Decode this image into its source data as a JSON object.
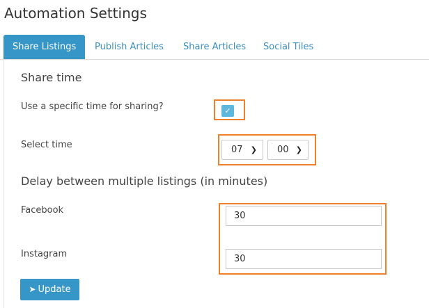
{
  "page": {
    "title": "Automation Settings"
  },
  "tabs": [
    {
      "label": "Share Listings",
      "active": true
    },
    {
      "label": "Publish Articles",
      "active": false
    },
    {
      "label": "Share Articles",
      "active": false
    },
    {
      "label": "Social Tiles",
      "active": false
    }
  ],
  "share_time": {
    "title": "Share time",
    "specific_time_label": "Use a specific time for sharing?",
    "specific_time_checked": true,
    "select_time_label": "Select time",
    "hour_value": "07",
    "minute_value": "00"
  },
  "delay": {
    "title": "Delay between multiple listings (in minutes)",
    "facebook_label": "Facebook",
    "facebook_value": "30",
    "instagram_label": "Instagram",
    "instagram_value": "30"
  },
  "actions": {
    "update_label": "Update",
    "update_icon": "paper-plane-icon"
  },
  "colors": {
    "accent": "#3796c8",
    "highlight": "#ee7f2d",
    "checkbox": "#5fb7de"
  }
}
